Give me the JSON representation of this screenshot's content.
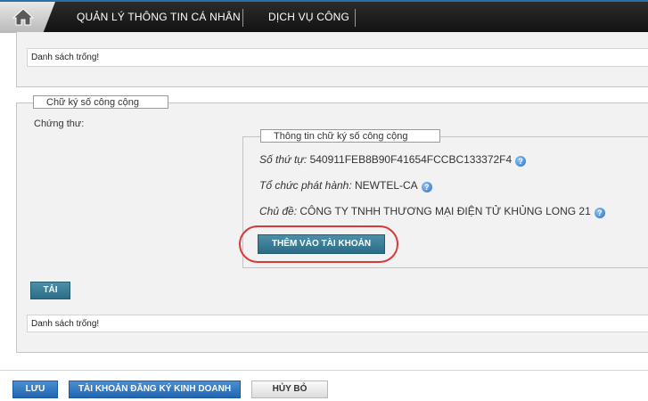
{
  "nav": {
    "items": [
      {
        "label": "QUẢN LÝ THÔNG TIN CÁ NHÂN"
      },
      {
        "label": "DỊCH VỤ CÔNG"
      }
    ]
  },
  "top_list": {
    "empty_text": "Danh sách trống!"
  },
  "public_signature": {
    "legend": "Chữ ký số công cộng",
    "certificate_label": "Chứng thư:",
    "info": {
      "legend": "Thông tin chữ ký số công cộng",
      "serial_label": "Số thứ tự:",
      "serial_value": "540911FEB8B90F41654FCCBC133372F4",
      "issuer_label": "Tổ chức phát hành:",
      "issuer_value": "NEWTEL-CA",
      "subject_label": "Chủ đề:",
      "subject_value": "CÔNG TY TNHH THƯƠNG MẠI ĐIỆN TỬ KHỦNG LONG 21",
      "add_button": "THÊM VÀO TÀI KHOẢN"
    },
    "load_button": "TẢI",
    "empty_text": "Danh sách trống!"
  },
  "footer": {
    "save_button": "LƯU",
    "business_button": "TÀI KHOẢN ĐĂNG KÝ KINH DOANH",
    "cancel_button": "HỦY BỎ"
  },
  "colors": {
    "nav_bg": "#1b1b1b",
    "teal_button": "#3a7d98",
    "blue_button": "#2d75c2",
    "highlight": "#d83a3a"
  }
}
